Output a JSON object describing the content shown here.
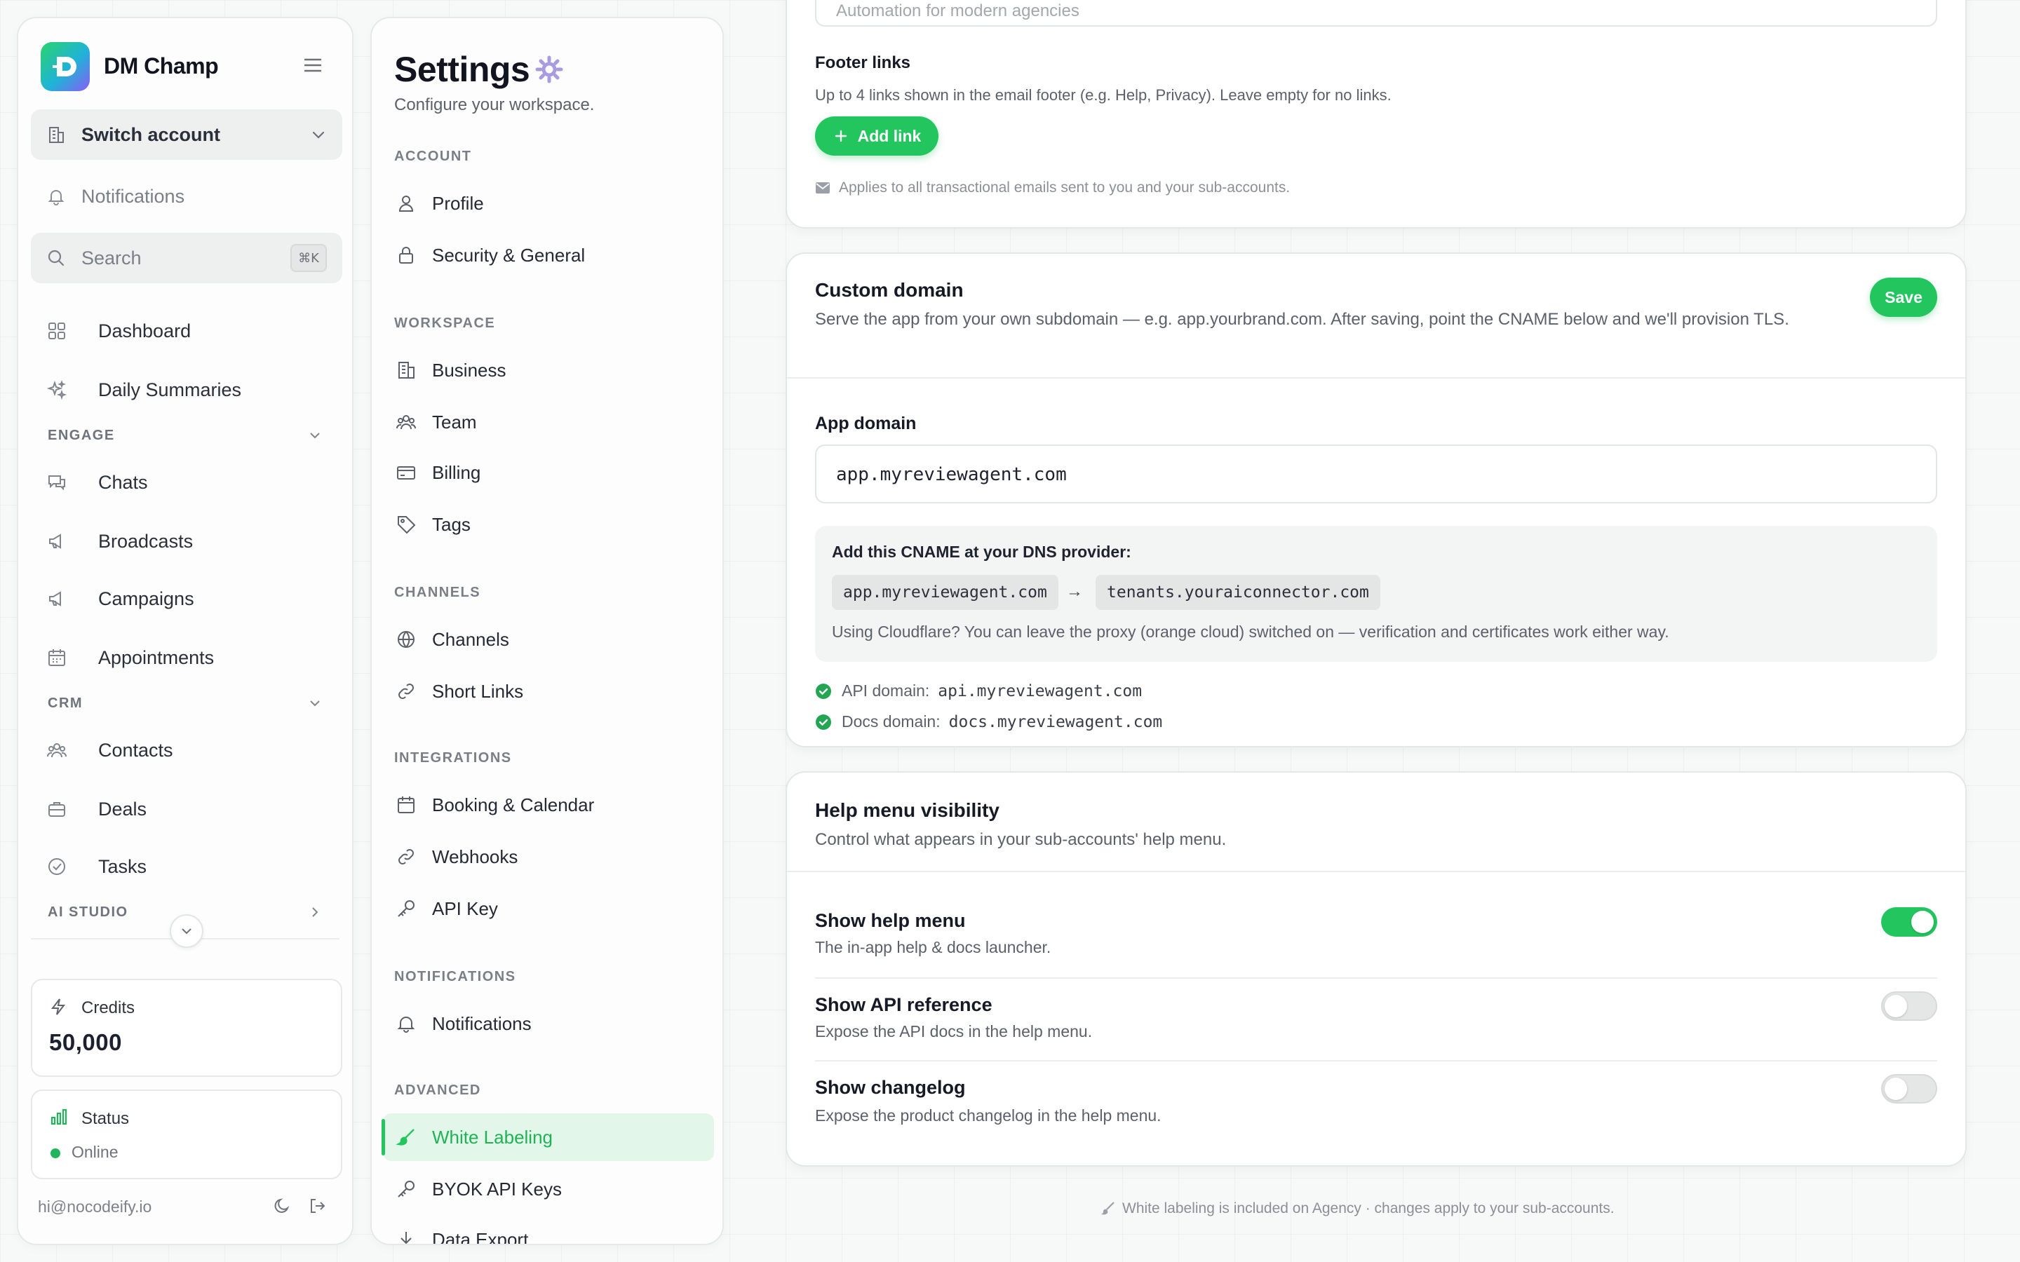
{
  "brand": {
    "name": "DM Champ",
    "logo_letter": "D"
  },
  "sidebar": {
    "switch_account": "Switch account",
    "notifications": "Notifications",
    "search_placeholder": "Search",
    "search_shortcut": "⌘K",
    "dashboard": "Dashboard",
    "daily_summaries": "Daily Summaries",
    "sections": {
      "engage": "ENGAGE",
      "crm": "CRM",
      "ai_studio": "AI STUDIO"
    },
    "engage_items": [
      "Chats",
      "Broadcasts",
      "Campaigns",
      "Appointments"
    ],
    "crm_items": [
      "Contacts",
      "Deals",
      "Tasks"
    ],
    "credits": {
      "label": "Credits",
      "value": "50,000"
    },
    "status": {
      "label": "Status",
      "value": "Online"
    },
    "email": "hi@nocodeify.io"
  },
  "settings_nav": {
    "title": "Settings",
    "subtitle": "Configure your workspace.",
    "sections": [
      "ACCOUNT",
      "WORKSPACE",
      "CHANNELS",
      "INTEGRATIONS",
      "NOTIFICATIONS",
      "ADVANCED"
    ],
    "items": {
      "profile": "Profile",
      "security": "Security & General",
      "business": "Business",
      "team": "Team",
      "billing": "Billing",
      "tags": "Tags",
      "channels": "Channels",
      "short_links": "Short Links",
      "booking": "Booking & Calendar",
      "webhooks": "Webhooks",
      "api_key": "API Key",
      "notifications": "Notifications",
      "white_labeling": "White Labeling",
      "byok": "BYOK API Keys",
      "data_export": "Data Export"
    },
    "active": "White Labeling"
  },
  "email_panel": {
    "tagline_placeholder": "Automation for modern agencies",
    "footer_links_label": "Footer links",
    "footer_links_help": "Up to 4 links shown in the email footer (e.g. Help, Privacy). Leave empty for no links.",
    "add_link": "Add link",
    "applies_note": "Applies to all transactional emails sent to you and your sub-accounts."
  },
  "custom_domain": {
    "title": "Custom domain",
    "description": "Serve the app from your own subdomain — e.g. app.yourbrand.com. After saving, point the CNAME below and we'll provision TLS.",
    "save": "Save",
    "app_domain_label": "App domain",
    "app_domain_value": "app.myreviewagent.com",
    "cname_heading": "Add this CNAME at your DNS provider:",
    "cname_from": "app.myreviewagent.com",
    "cname_arrow": "→",
    "cname_to": "tenants.youraiconnector.com",
    "cloudflare_note": "Using Cloudflare? You can leave the proxy (orange cloud) switched on — verification and certificates work either way.",
    "api_domain_label": "API domain:",
    "api_domain_value": "api.myreviewagent.com",
    "docs_domain_label": "Docs domain:",
    "docs_domain_value": "docs.myreviewagent.com"
  },
  "help_menu": {
    "title": "Help menu visibility",
    "description": "Control what appears in your sub-accounts' help menu.",
    "toggles": [
      {
        "title": "Show help menu",
        "desc": "The in-app help & docs launcher.",
        "on": true
      },
      {
        "title": "Show API reference",
        "desc": "Expose the API docs in the help menu.",
        "on": false
      },
      {
        "title": "Show changelog",
        "desc": "Expose the product changelog in the help menu.",
        "on": false
      }
    ]
  },
  "footer_note": "White labeling is included on Agency · changes apply to your sub-accounts.",
  "colors": {
    "accent": "#22c55e",
    "accent_soft": "#e3f6ea",
    "text": "#1f2330",
    "muted": "#5b606a"
  }
}
